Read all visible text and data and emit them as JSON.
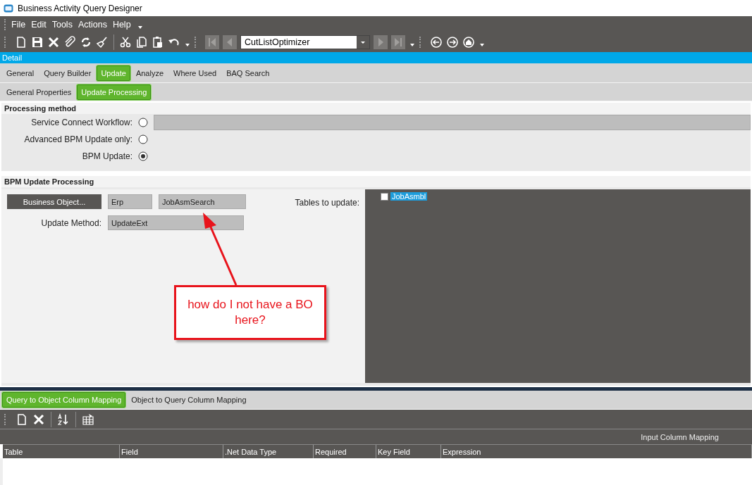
{
  "window": {
    "title": "Business Activity Query Designer"
  },
  "menu": [
    "File",
    "Edit",
    "Tools",
    "Actions",
    "Help"
  ],
  "toolbar": {
    "record": "CutListOptimizer"
  },
  "detail_bar": {
    "label": "Detail"
  },
  "tabs": [
    {
      "label": "General",
      "selected": false
    },
    {
      "label": "Query Builder",
      "selected": false
    },
    {
      "label": "Update",
      "selected": true
    },
    {
      "label": "Analyze",
      "selected": false
    },
    {
      "label": "Where Used",
      "selected": false
    },
    {
      "label": "BAQ Search",
      "selected": false
    }
  ],
  "subtabs": [
    {
      "label": "General Properties",
      "selected": false
    },
    {
      "label": "Update  Processing",
      "selected": true
    }
  ],
  "processing_method": {
    "title": "Processing method",
    "options": [
      {
        "label": "Service Connect Workflow:",
        "selected": false,
        "kind": "field"
      },
      {
        "label": "Advanced BPM Update only:",
        "selected": false,
        "kind": "plain"
      },
      {
        "label": "BPM Update:",
        "selected": true,
        "kind": "plain"
      }
    ]
  },
  "bpm": {
    "title": "BPM Update Processing",
    "business_object_button": "Business Object...",
    "namespace": "Erp",
    "object": "JobAsmSearch",
    "update_method_label": "Update Method:",
    "update_method": "UpdateExt",
    "tables_label": "Tables to update:",
    "tables": [
      {
        "name": "JobAsmbl",
        "checked": false,
        "selected": true
      }
    ]
  },
  "callout": {
    "text": "how do I not have a BO here?"
  },
  "bottom_tabs": [
    {
      "label": "Query to Object Column Mapping",
      "selected": true
    },
    {
      "label": "Object to Query Column Mapping",
      "selected": false
    }
  ],
  "grid": {
    "band": "Input Column Mapping",
    "columns": [
      "Table",
      "Field",
      ".Net Data Type",
      "Required",
      "Key Field",
      "Expression"
    ]
  }
}
